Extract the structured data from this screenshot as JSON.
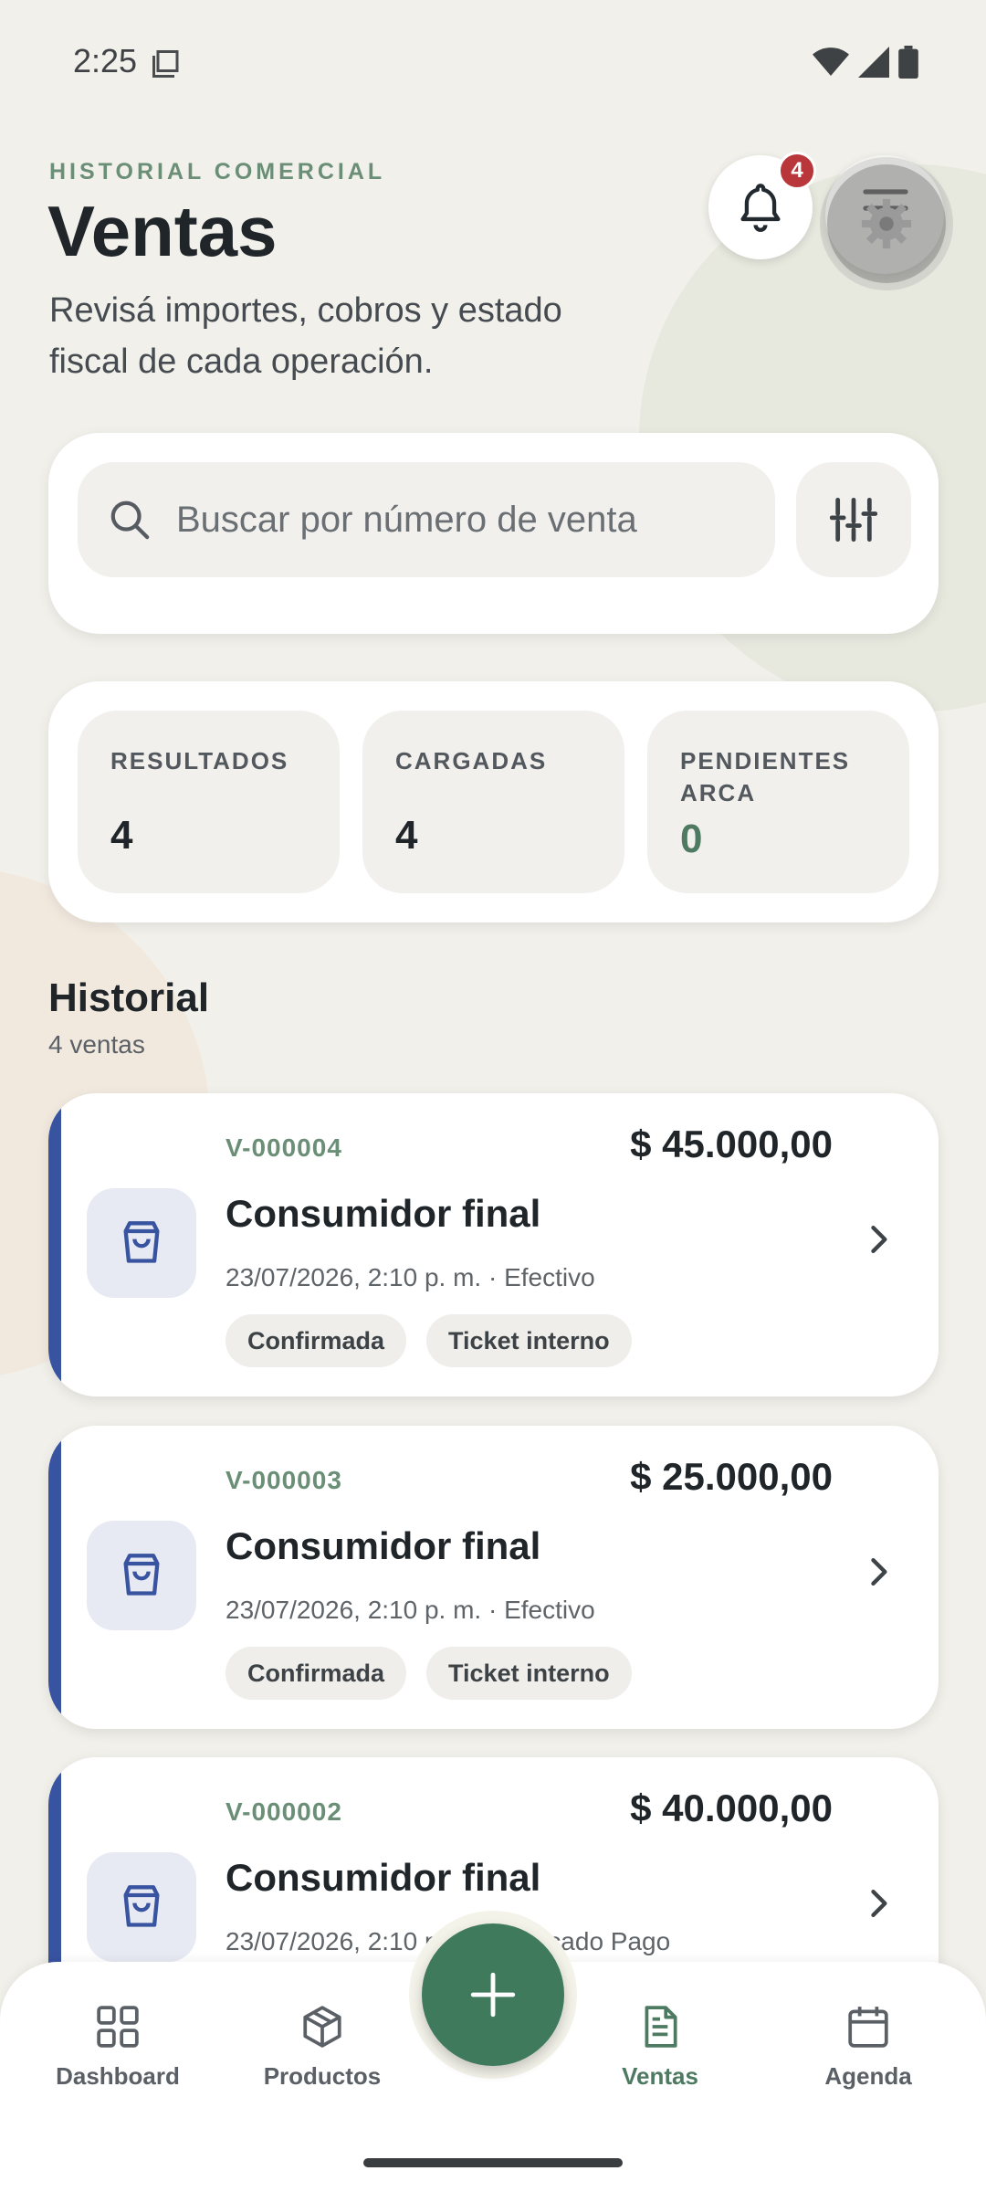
{
  "status_bar": {
    "time": "2:25"
  },
  "header": {
    "eyebrow": "HISTORIAL COMERCIAL",
    "title": "Ventas",
    "subtitle": "Revisá importes, cobros y estado fiscal de cada operación.",
    "notifications_count": "4"
  },
  "search": {
    "placeholder": "Buscar por número de venta"
  },
  "stats": [
    {
      "label": "RESULTADOS",
      "value": "4"
    },
    {
      "label": "CARGADAS",
      "value": "4"
    },
    {
      "label": "PENDIENTES ARCA",
      "value": "0"
    }
  ],
  "historial": {
    "title": "Historial",
    "count": "4 ventas",
    "sales": [
      {
        "number": "V-000004",
        "amount": "$ 45.000,00",
        "customer": "Consumidor final",
        "meta": "23/07/2026, 2:10 p. m. · Efectivo",
        "chips": [
          "Confirmada",
          "Ticket interno"
        ]
      },
      {
        "number": "V-000003",
        "amount": "$ 25.000,00",
        "customer": "Consumidor final",
        "meta": "23/07/2026, 2:10 p. m. · Efectivo",
        "chips": [
          "Confirmada",
          "Ticket interno"
        ]
      },
      {
        "number": "V-000002",
        "amount": "$ 40.000,00",
        "customer": "Consumidor final",
        "meta": "23/07/2026, 2:10 p. m. · Mercado Pago",
        "chips": []
      }
    ]
  },
  "nav": [
    {
      "label": "Dashboard",
      "icon": "grid-icon"
    },
    {
      "label": "Productos",
      "icon": "box-icon"
    },
    {
      "label": "Ventas",
      "icon": "receipt-icon"
    },
    {
      "label": "Agenda",
      "icon": "calendar-icon"
    }
  ],
  "colors": {
    "accent": "#3f7a5d",
    "card_accent": "#3853a0",
    "eyebrow": "#6b8e77",
    "badge": "#b9363a"
  }
}
